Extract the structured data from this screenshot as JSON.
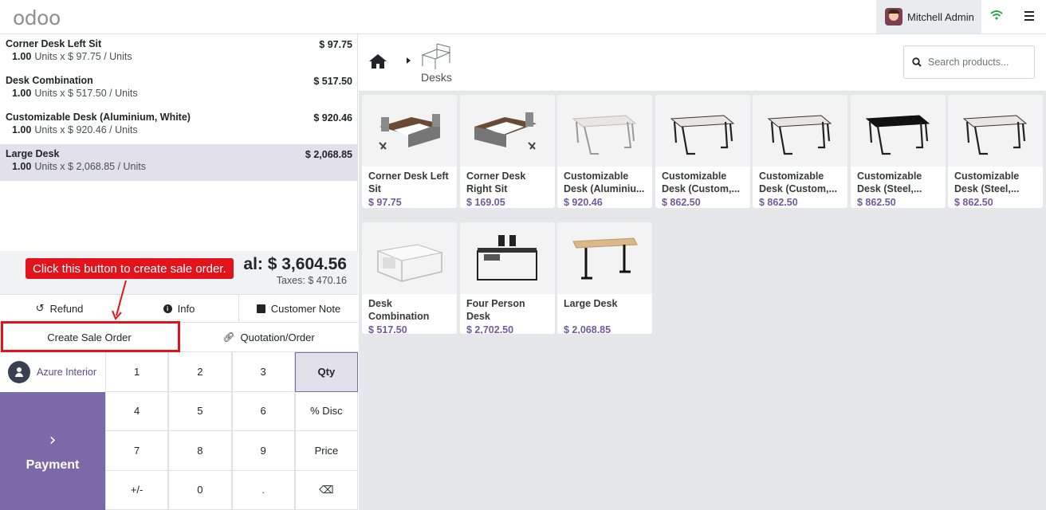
{
  "app": {
    "logo": "odoo"
  },
  "header": {
    "user_name": "Mitchell Admin"
  },
  "order": {
    "lines": [
      {
        "name": "Corner Desk Left Sit",
        "price": "$ 97.75",
        "qty": "1.00",
        "detail": "Units x $ 97.75 / Units"
      },
      {
        "name": "Desk Combination",
        "price": "$ 517.50",
        "qty": "1.00",
        "detail": "Units x $ 517.50 / Units"
      },
      {
        "name": "Customizable Desk (Aluminium, White)",
        "price": "$ 920.46",
        "qty": "1.00",
        "detail": "Units x $ 920.46 / Units"
      },
      {
        "name": "Large Desk",
        "price": "$ 2,068.85",
        "qty": "1.00",
        "detail": "Units x $ 2,068.85 / Units"
      }
    ],
    "total": "al: $ 3,604.56",
    "taxes": "Taxes: $ 470.16"
  },
  "controls": {
    "refund": "Refund",
    "info": "Info",
    "customer_note": "Customer Note",
    "create_sale_order": "Create Sale Order",
    "quotation_order": "Quotation/Order"
  },
  "customer": {
    "name": "Azure Interior"
  },
  "payment": {
    "label": "Payment"
  },
  "numpad": {
    "keys": [
      "1",
      "2",
      "3",
      "Qty",
      "4",
      "5",
      "6",
      "% Disc",
      "7",
      "8",
      "9",
      "Price",
      "+/-",
      "0",
      ".",
      "⌫"
    ]
  },
  "catalog": {
    "category": "Desks",
    "search_placeholder": "Search products...",
    "products": [
      {
        "name": "Corner Desk Left Sit",
        "price": "$ 97.75"
      },
      {
        "name": "Corner Desk Right Sit",
        "price": "$ 169.05"
      },
      {
        "name": "Customizable Desk (Aluminiu...",
        "price": "$ 920.46"
      },
      {
        "name": "Customizable Desk (Custom,...",
        "price": "$ 862.50"
      },
      {
        "name": "Customizable Desk (Custom,...",
        "price": "$ 862.50"
      },
      {
        "name": "Customizable Desk (Steel,...",
        "price": "$ 862.50"
      },
      {
        "name": "Customizable Desk (Steel,...",
        "price": "$ 862.50"
      },
      {
        "name": "Desk Combination",
        "price": "$ 517.50"
      },
      {
        "name": "Four Person Desk",
        "price": "$ 2,702.50"
      },
      {
        "name": "Large Desk",
        "price": "$ 2,068.85"
      }
    ]
  },
  "annotation": {
    "callout": "Click this button to create sale order."
  },
  "colors": {
    "accent": "#7a6aa8",
    "price": "#6d5ba3",
    "annotation": "#e3131b"
  }
}
